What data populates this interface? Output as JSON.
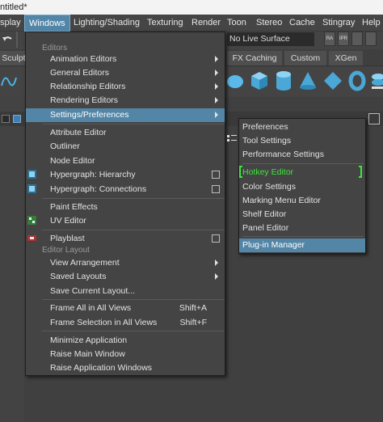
{
  "window": {
    "title": "ntitled*"
  },
  "menubar": {
    "items": [
      "splay",
      "Windows",
      "Lighting/Shading",
      "Texturing",
      "Render",
      "Toon",
      "Stereo",
      "Cache",
      "Stingray",
      "Help"
    ],
    "active": "Windows"
  },
  "toolbar": {
    "live_surface": "No Live Surface",
    "icon_labels": [
      "RA",
      "IPR"
    ]
  },
  "shelf_tabs": [
    "Sculpt",
    "FX Caching",
    "Custom",
    "XGen"
  ],
  "windows_menu": {
    "section_editors": "Editors",
    "items_1": [
      {
        "label": "Animation Editors",
        "submenu": true
      },
      {
        "label": "General Editors",
        "submenu": true
      },
      {
        "label": "Relationship Editors",
        "submenu": true
      },
      {
        "label": "Rendering Editors",
        "submenu": true
      },
      {
        "label": "Settings/Preferences",
        "submenu": true,
        "selected": true
      }
    ],
    "items_2": [
      {
        "label": "Attribute Editor"
      },
      {
        "label": "Outliner"
      },
      {
        "label": "Node Editor"
      },
      {
        "label": "Hypergraph: Hierarchy",
        "checkbox": true
      },
      {
        "label": "Hypergraph: Connections",
        "checkbox": true
      }
    ],
    "items_3": [
      {
        "label": "Paint Effects"
      },
      {
        "label": "UV Editor"
      }
    ],
    "playblast": {
      "label": "Playblast",
      "checkbox": true
    },
    "section_layout": "Editor Layout",
    "items_4": [
      {
        "label": "View Arrangement",
        "submenu": true
      },
      {
        "label": "Saved Layouts",
        "submenu": true
      },
      {
        "label": "Save Current Layout..."
      }
    ],
    "items_5": [
      {
        "label": "Frame All in All Views",
        "shortcut": "Shift+A"
      },
      {
        "label": "Frame Selection in All Views",
        "shortcut": "Shift+F"
      }
    ],
    "items_6": [
      {
        "label": "Minimize Application"
      },
      {
        "label": "Raise Main Window"
      },
      {
        "label": "Raise Application Windows"
      }
    ]
  },
  "settings_submenu": {
    "items": [
      "Preferences",
      "Tool Settings",
      "Performance Settings",
      "Hotkey Editor",
      "Color Settings",
      "Marking Menu Editor",
      "Shelf Editor",
      "Panel Editor",
      "Plug-in Manager"
    ],
    "highlighted": "Hotkey Editor",
    "selected": "Plug-in Manager"
  },
  "colors": {
    "accent": "#5285a6",
    "highlight_green": "#3de63d",
    "background": "#444444"
  }
}
